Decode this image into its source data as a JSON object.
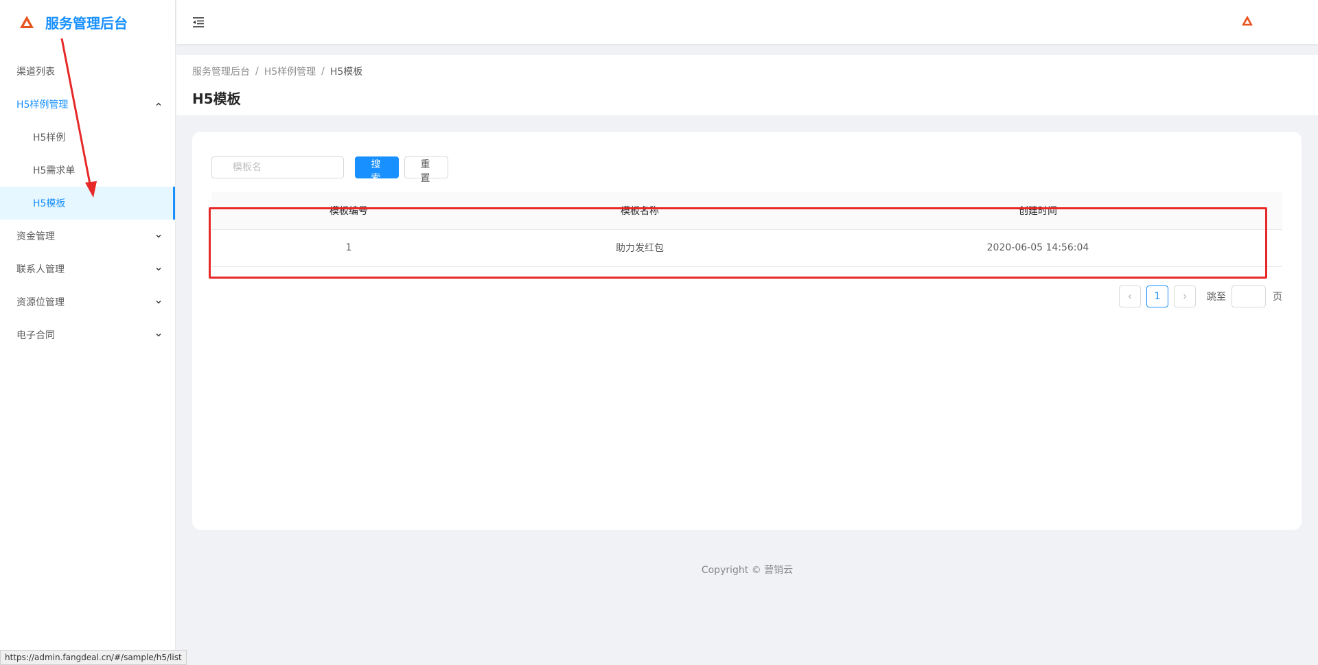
{
  "app": {
    "title": "服务管理后台",
    "brand_color": "#1890ff",
    "logo_color": "#e8541f"
  },
  "sidebar": {
    "items": [
      {
        "label": "渠道列表"
      },
      {
        "label": "H5样例管理",
        "open": true,
        "children": [
          {
            "label": "H5样例"
          },
          {
            "label": "H5需求单"
          },
          {
            "label": "H5模板",
            "active": true
          }
        ]
      },
      {
        "label": "资金管理"
      },
      {
        "label": "联系人管理"
      },
      {
        "label": "资源位管理"
      },
      {
        "label": "电子合同"
      }
    ]
  },
  "breadcrumb": [
    "服务管理后台",
    "H5样例管理",
    "H5模板"
  ],
  "page_title": "H5模板",
  "search": {
    "placeholder": "模板名",
    "value": "",
    "search_label": "搜索",
    "reset_label": "重置"
  },
  "table": {
    "columns": [
      "模板编号",
      "模板名称",
      "创建时间"
    ],
    "rows": [
      [
        "1",
        "助力发红包",
        "2020-06-05 14:56:04"
      ]
    ]
  },
  "pagination": {
    "current": "1",
    "jump_label": "跳至",
    "jump_suffix": "页"
  },
  "footer": "Copyright © 营销云",
  "status_url": "https://admin.fangdeal.cn/#/sample/h5/list",
  "annotation_color": "#e62828"
}
